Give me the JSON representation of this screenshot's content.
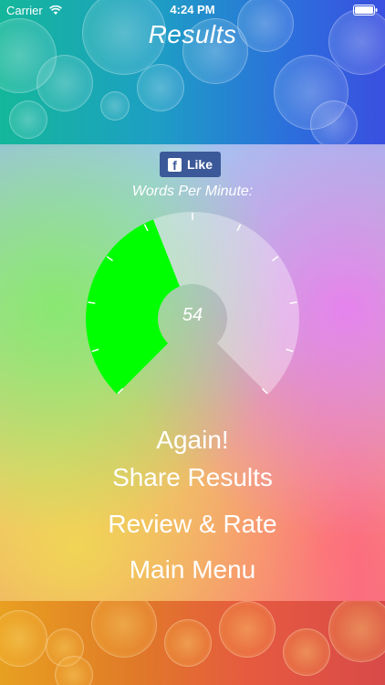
{
  "status_bar": {
    "carrier": "Carrier",
    "time": "4:24 PM"
  },
  "header": {
    "title": "Results"
  },
  "like_button": {
    "label": "Like",
    "icon": "facebook-icon",
    "color": "#3b5998"
  },
  "gauge": {
    "label": "Words Per Minute:",
    "value": "54",
    "fraction_filled": 0.42,
    "fill_color": "#00ff00",
    "track_color": "#ffffff"
  },
  "menu": {
    "again": "Again!",
    "share": "Share Results",
    "review": "Review & Rate",
    "main_menu": "Main Menu"
  }
}
